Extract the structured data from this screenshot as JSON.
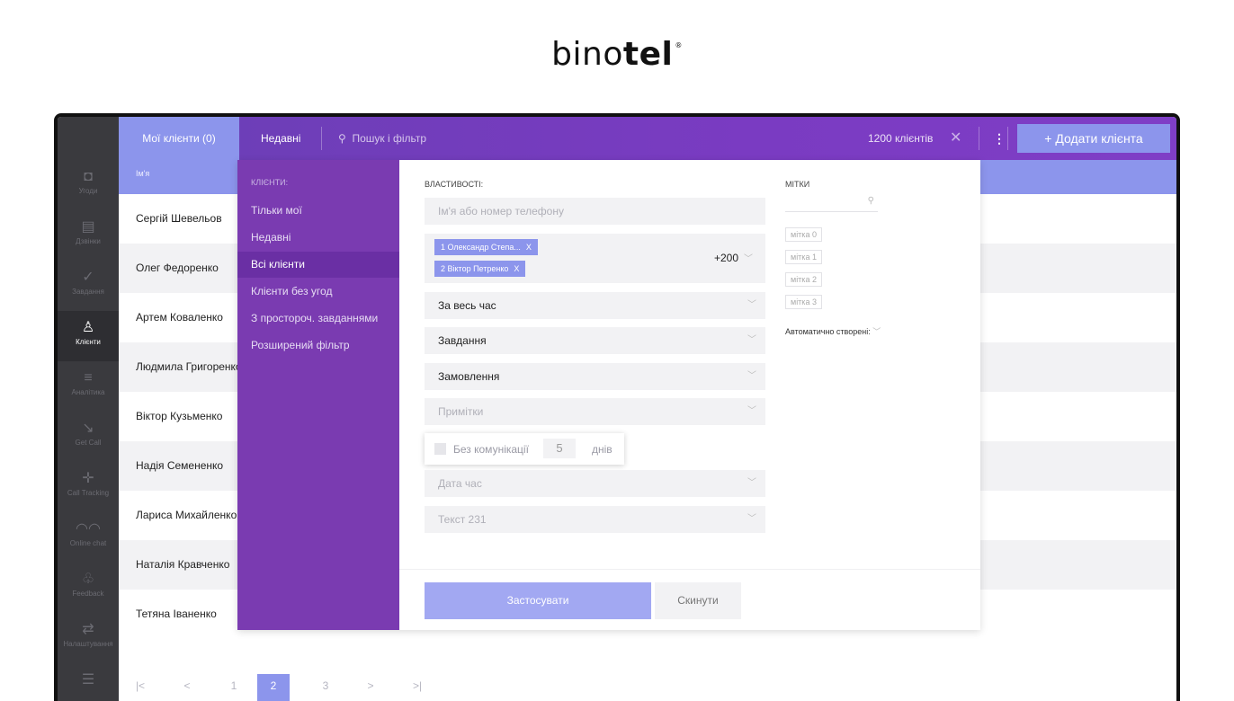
{
  "logo": {
    "part1": "bino",
    "part2": "tel",
    "mark": "®"
  },
  "sidebar": {
    "items": [
      {
        "icon": "deals-icon",
        "glyph": "◘",
        "label": "Угоди"
      },
      {
        "icon": "calls-icon",
        "glyph": "▤",
        "label": "Дзвінки"
      },
      {
        "icon": "tasks-icon",
        "glyph": "✓",
        "label": "Завдання"
      },
      {
        "icon": "clients-icon",
        "glyph": "♙",
        "label": "Клієнти"
      },
      {
        "icon": "analytics-icon",
        "glyph": "≡",
        "label": "Аналітика"
      },
      {
        "icon": "getcall-icon",
        "glyph": "↘",
        "label": "Get Call"
      },
      {
        "icon": "calltracking-icon",
        "glyph": "✛",
        "label": "Call Tracking"
      },
      {
        "icon": "onlinechat-icon",
        "glyph": "◠◠",
        "label": "Online chat"
      },
      {
        "icon": "feedback-icon",
        "glyph": "♧",
        "label": "Feedback"
      },
      {
        "icon": "settings-icon",
        "glyph": "⇄",
        "label": "Налаштування"
      },
      {
        "icon": "menu-icon",
        "glyph": "☰",
        "label": ""
      }
    ]
  },
  "topbar": {
    "tab_my": "Мої клієнти (0)",
    "tab_recent": "Недавні",
    "search_icon": "search-icon",
    "search_placeholder": "Пошук і фільтр",
    "count": "1200 клієнтів",
    "close": "✕",
    "kebab": "⋮",
    "add_button": "+ Додати клієнта"
  },
  "table": {
    "column_name": "Ім'я",
    "rows": [
      "Сергій Шевельов",
      "Олег Федоренко",
      "Артем Коваленко",
      "Людмила Григоренко",
      "Віктор Кузьменко",
      "Надія Семененко",
      "Лариса Михайленко",
      "Наталія Кравченко",
      "Тетяна Іваненко"
    ]
  },
  "pagination": {
    "first": "|<",
    "prev": "<",
    "pages": [
      "1",
      "2",
      "3"
    ],
    "current": "2",
    "next": ">",
    "last": ">|"
  },
  "filter_menu": {
    "title": "КЛІЄНТИ:",
    "items": [
      "Тільки мої",
      "Недавні",
      "Всі клієнти",
      "Клієнти без угод",
      "З простороч. завданнями",
      "Розширений фільтр"
    ],
    "active": "Всі клієнти"
  },
  "properties": {
    "title": "ВЛАСТИВОСТІ:",
    "name_or_phone_placeholder": "Ім'я або номер телефону",
    "chips": [
      "1 Олександр Степа...",
      "2 Віктор Петренко"
    ],
    "chip_remove": "X",
    "more_count": "+200",
    "period": "За весь час",
    "tasks": "Завдання",
    "orders": "Замовлення",
    "notes": "Примітки",
    "no_comm_label": "Без комунікації",
    "no_comm_value": "5",
    "no_comm_unit": "днів",
    "datetime": "Дата час",
    "text231": "Текст 231"
  },
  "tags": {
    "title": "МІТКИ",
    "items": [
      "мітка 0",
      "мітка 1",
      "мітка 2",
      "мітка 3"
    ],
    "auto_created": "Автоматично створені:"
  },
  "actions": {
    "apply": "Застосувати",
    "reset": "Скинути"
  }
}
